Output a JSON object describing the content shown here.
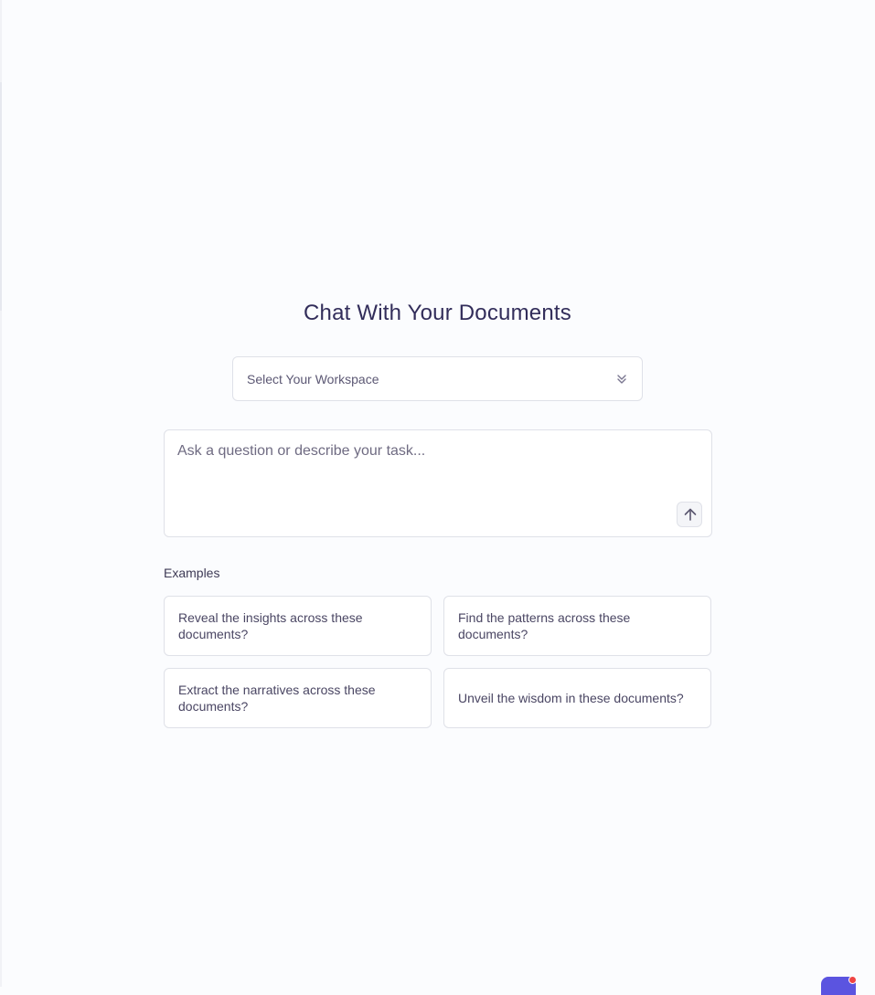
{
  "main": {
    "title": "Chat With Your Documents",
    "workspace_select": {
      "selected": "Select Your Workspace",
      "icon": "chevron-down-icon"
    },
    "chat_input": {
      "placeholder": "Ask a question or describe your task...",
      "value": "",
      "send_icon": "arrow-up-icon"
    },
    "examples": {
      "label": "Examples",
      "items": [
        "Reveal the insights across these documents?",
        "Find the patterns across these documents?",
        "Extract the narratives across these documents?",
        "Unveil the wisdom in these documents?"
      ]
    }
  },
  "widget": {
    "icon": "chat-widget-icon",
    "accent": "#5b54e0",
    "notification_color": "#ef4444"
  }
}
